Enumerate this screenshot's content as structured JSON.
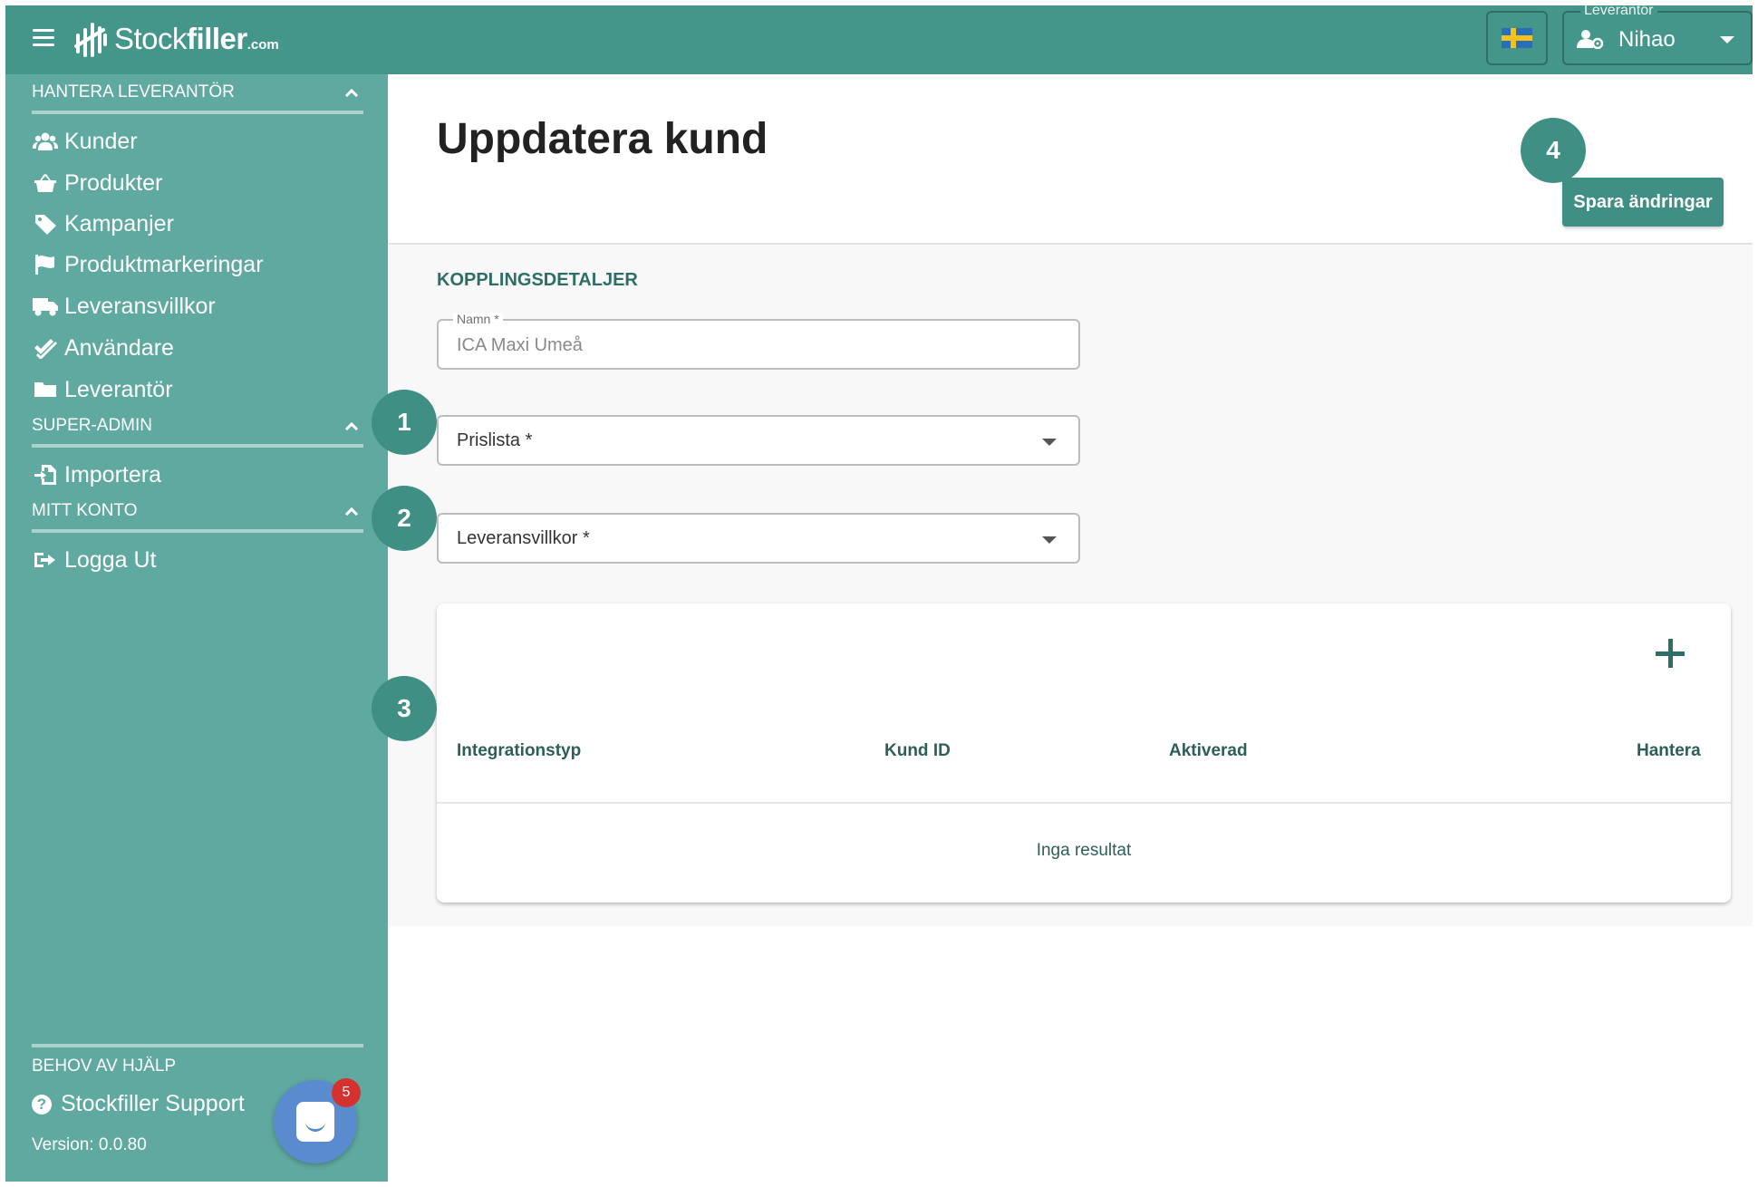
{
  "topbar": {
    "logo_text_main": "Stock",
    "logo_text_bold": "filler",
    "logo_text_suffix": ".com",
    "flag": "sweden-flag-icon",
    "supplier_legend": "Leverantör",
    "supplier_value": "Nihao"
  },
  "sidebar": {
    "section1": "HANTERA LEVERANTÖR",
    "items1": [
      {
        "label": "Kunder",
        "icon": "users-icon"
      },
      {
        "label": "Produkter",
        "icon": "basket-icon"
      },
      {
        "label": "Kampanjer",
        "icon": "tag-icon"
      },
      {
        "label": "Produktmarkeringar",
        "icon": "flag-icon"
      },
      {
        "label": "Leveransvillkor",
        "icon": "truck-icon"
      },
      {
        "label": "Användare",
        "icon": "check-double-icon"
      },
      {
        "label": "Leverantör",
        "icon": "folder-icon"
      }
    ],
    "section2": "SUPER-ADMIN",
    "items2": [
      {
        "label": "Importera",
        "icon": "import-icon"
      }
    ],
    "section3": "MITT KONTO",
    "items3": [
      {
        "label": "Logga Ut",
        "icon": "logout-icon"
      }
    ],
    "help_title": "BEHOV AV HJÄLP",
    "support_label": "Stockfiller Support",
    "version": "Version: 0.0.80",
    "chat_badge": "5"
  },
  "main": {
    "title": "Uppdatera kund",
    "save_label": "Spara ändringar",
    "section_label": "KOPPLINGSDETALJER",
    "name_legend": "Namn *",
    "name_value": "ICA Maxi Umeå",
    "pricelist_label": "Prislista *",
    "delivery_label": "Leveransvillkor *",
    "table": {
      "headers": [
        "Integrationstyp",
        "Kund ID",
        "Aktiverad",
        "Hantera"
      ],
      "empty": "Inga resultat"
    }
  },
  "markers": [
    "1",
    "2",
    "3",
    "4"
  ],
  "colors": {
    "brand": "#44958a",
    "sidebar": "#5fa9a0",
    "accent": "#3f8f84"
  }
}
